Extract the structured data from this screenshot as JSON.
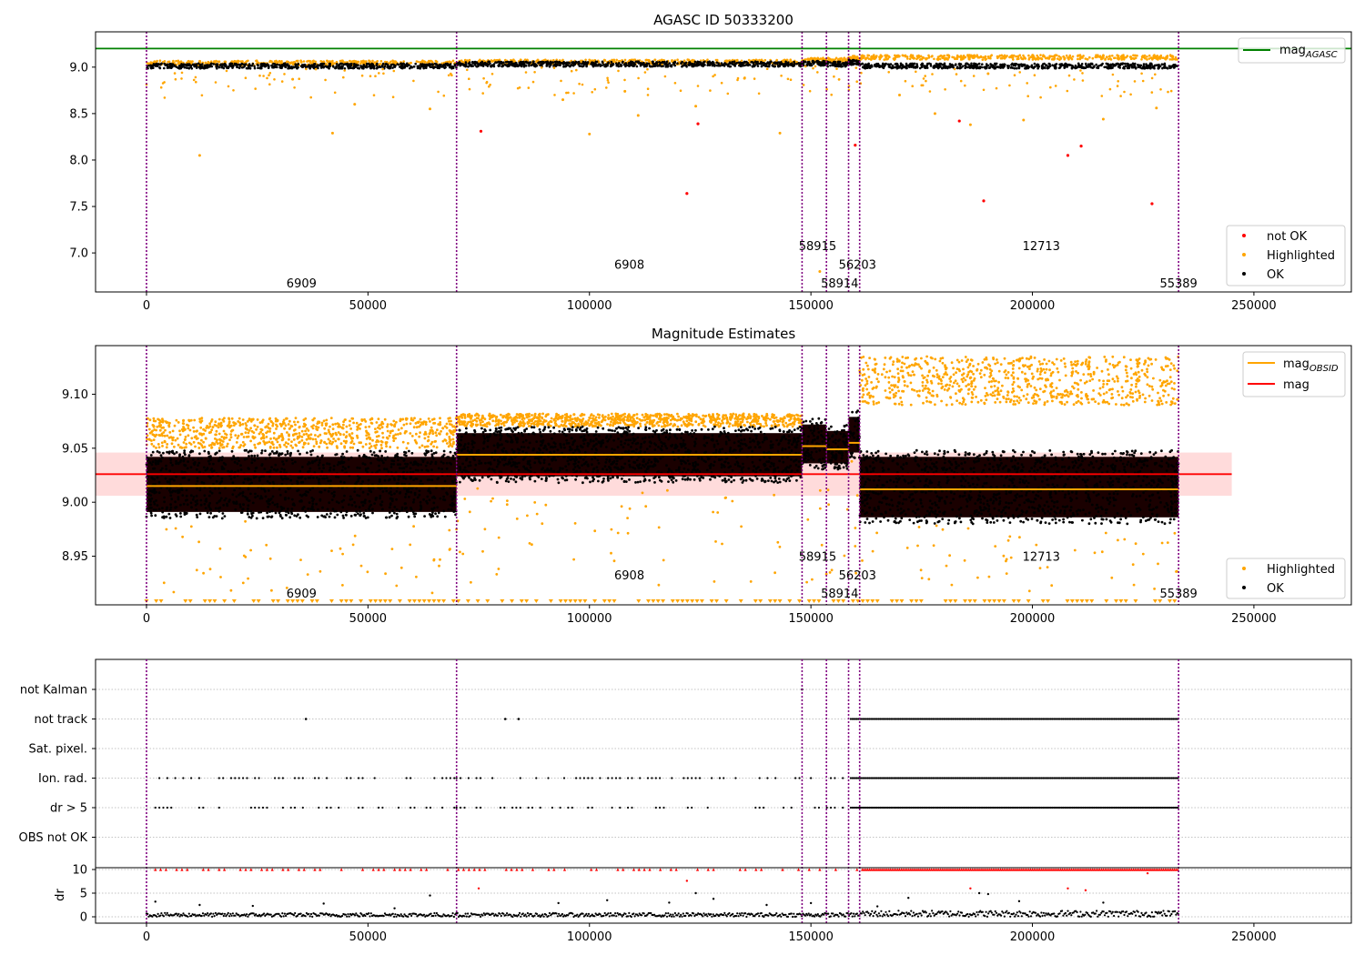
{
  "figure": {
    "colors": {
      "ok": "#000000",
      "highlighted": "#ffa500",
      "not_ok": "#ff0000",
      "agasc_line": "#008000",
      "mag_line": "#ff0000",
      "mag_band": "#ffcccc",
      "obsid_line": "#ffa500",
      "boundary": "#800080",
      "grid": "#b0b0b0"
    }
  },
  "chart_data": [
    {
      "type": "scatter",
      "title": "AGASC ID 50333200",
      "xlabel": "",
      "ylabel": "",
      "xlim": [
        -11500,
        272000
      ],
      "ylim": [
        6.58,
        9.38
      ],
      "x_ticks": [
        0,
        50000,
        100000,
        150000,
        200000,
        250000
      ],
      "x_tick_labels": [
        "0",
        "50000",
        "100000",
        "150000",
        "200000",
        "250000"
      ],
      "y_ticks": [
        7.0,
        7.5,
        8.0,
        8.5,
        9.0
      ],
      "y_tick_labels": [
        "7.0",
        "7.5",
        "8.0",
        "8.5",
        "9.0"
      ],
      "mag_agasc": 9.2,
      "obs_boundaries": [
        0,
        70000,
        148000,
        153500,
        158500,
        161000,
        233000
      ],
      "obs_labels": [
        {
          "text": "6909",
          "x": 35000,
          "y": 6.68
        },
        {
          "text": "6908",
          "x": 109000,
          "y": 6.88
        },
        {
          "text": "58915",
          "x": 151500,
          "y": 7.08
        },
        {
          "text": "58914",
          "x": 156500,
          "y": 6.68
        },
        {
          "text": "56203",
          "x": 160500,
          "y": 6.88
        },
        {
          "text": "12713",
          "x": 202000,
          "y": 7.08
        },
        {
          "text": "55389",
          "x": 233000,
          "y": 6.68
        }
      ],
      "bands": [
        {
          "x0": 0,
          "x1": 70000,
          "ok": 9.02,
          "hl": 9.05
        },
        {
          "x0": 70000,
          "x1": 148000,
          "ok": 9.04,
          "hl": 9.06
        },
        {
          "x0": 148000,
          "x1": 153500,
          "ok": 9.05,
          "hl": 9.08
        },
        {
          "x0": 153500,
          "x1": 158500,
          "ok": 9.04,
          "hl": 9.08
        },
        {
          "x0": 158500,
          "x1": 161000,
          "ok": 9.06,
          "hl": 9.1
        },
        {
          "x0": 161000,
          "x1": 233000,
          "ok": 9.02,
          "hl": 9.11
        }
      ],
      "highlighted_outliers": [
        [
          12000,
          8.05
        ],
        [
          42000,
          8.29
        ],
        [
          100000,
          8.28
        ],
        [
          143000,
          8.29
        ],
        [
          152000,
          6.8
        ],
        [
          178000,
          8.5
        ],
        [
          186000,
          8.38
        ],
        [
          198000,
          8.43
        ],
        [
          216000,
          8.44
        ],
        [
          228000,
          8.56
        ],
        [
          33000,
          8.87
        ],
        [
          47000,
          8.6
        ],
        [
          64000,
          8.55
        ],
        [
          94000,
          8.65
        ],
        [
          108000,
          8.74
        ],
        [
          111000,
          8.48
        ],
        [
          124000,
          8.58
        ],
        [
          135000,
          8.88
        ],
        [
          170000,
          8.7
        ],
        [
          190000,
          8.93
        ]
      ],
      "not_ok_points": [
        [
          75500,
          8.31
        ],
        [
          124500,
          8.39
        ],
        [
          122000,
          7.64
        ],
        [
          160000,
          8.16
        ],
        [
          183500,
          8.42
        ],
        [
          189000,
          7.56
        ],
        [
          208000,
          8.05
        ],
        [
          211000,
          8.15
        ],
        [
          227000,
          7.53
        ]
      ],
      "legend_line": [
        "mag_AGASC"
      ],
      "legend_points": [
        "not OK",
        "Highlighted",
        "OK"
      ]
    },
    {
      "type": "scatter",
      "title": "Magnitude Estimates",
      "xlabel": "",
      "ylabel": "",
      "xlim": [
        -11500,
        272000
      ],
      "ylim": [
        8.905,
        9.145
      ],
      "x_ticks": [
        0,
        50000,
        100000,
        150000,
        200000,
        250000
      ],
      "x_tick_labels": [
        "0",
        "50000",
        "100000",
        "150000",
        "200000",
        "250000"
      ],
      "y_ticks": [
        8.95,
        9.0,
        9.05,
        9.1
      ],
      "y_tick_labels": [
        "8.95",
        "9.00",
        "9.05",
        "9.10"
      ],
      "mag": 9.026,
      "mag_band": [
        9.006,
        9.046
      ],
      "mag_obsid": [
        {
          "x0": 0,
          "x1": 70000,
          "y": 9.015
        },
        {
          "x0": 70000,
          "x1": 148000,
          "y": 9.044
        },
        {
          "x0": 148000,
          "x1": 153500,
          "y": 9.052
        },
        {
          "x0": 153500,
          "x1": 158500,
          "y": 9.049
        },
        {
          "x0": 158500,
          "x1": 161000,
          "y": 9.055
        },
        {
          "x0": 161000,
          "x1": 233000,
          "y": 9.012
        }
      ],
      "ok_bands": [
        {
          "x0": 0,
          "x1": 70000,
          "lo": 8.985,
          "hi": 9.048
        },
        {
          "x0": 70000,
          "x1": 148000,
          "lo": 9.018,
          "hi": 9.07
        },
        {
          "x0": 148000,
          "x1": 153500,
          "lo": 9.03,
          "hi": 9.078
        },
        {
          "x0": 153500,
          "x1": 158500,
          "lo": 9.03,
          "hi": 9.072
        },
        {
          "x0": 158500,
          "x1": 161000,
          "lo": 9.04,
          "hi": 9.085
        },
        {
          "x0": 161000,
          "x1": 233000,
          "lo": 8.98,
          "hi": 9.048
        }
      ],
      "hl_bands": [
        {
          "x0": 0,
          "x1": 70000,
          "lo": 9.05,
          "hi": 9.078
        },
        {
          "x0": 70000,
          "x1": 148000,
          "lo": 9.07,
          "hi": 9.082
        },
        {
          "x0": 161000,
          "x1": 233000,
          "lo": 9.09,
          "hi": 9.135
        }
      ],
      "obs_boundaries": [
        0,
        70000,
        148000,
        153500,
        158500,
        161000,
        233000
      ],
      "obs_labels": [
        {
          "text": "6909",
          "x": 35000,
          "y": 8.916
        },
        {
          "text": "6908",
          "x": 109000,
          "y": 8.933
        },
        {
          "text": "58915",
          "x": 151500,
          "y": 8.95
        },
        {
          "text": "58914",
          "x": 156500,
          "y": 8.916
        },
        {
          "text": "56203",
          "x": 160500,
          "y": 8.933
        },
        {
          "text": "12713",
          "x": 202000,
          "y": 8.95
        },
        {
          "text": "55389",
          "x": 233000,
          "y": 8.916
        }
      ],
      "legend_line": [
        "mag_OBSID",
        "mag"
      ],
      "legend_points": [
        "Highlighted",
        "OK"
      ]
    },
    {
      "type": "scatter",
      "title": "",
      "xlabel": "",
      "ylabel": "",
      "xlim": [
        -11500,
        272000
      ],
      "x_ticks": [
        0,
        50000,
        100000,
        150000,
        200000,
        250000
      ],
      "x_tick_labels": [
        "0",
        "50000",
        "100000",
        "150000",
        "200000",
        "250000"
      ],
      "flag_rows": [
        "not Kalman",
        "not track",
        "Sat. pixel.",
        "Ion. rad.",
        "dr > 5",
        "OBS not OK"
      ],
      "flag_points": {
        "not Kalman": [
          [
            148000,
            148500
          ]
        ],
        "not track": [
          [
            36000,
            36500
          ],
          [
            81000,
            81500
          ],
          [
            84000,
            84500
          ],
          [
            159000,
            233000
          ]
        ],
        "Sat. pixel.": [],
        "Ion. rad.": [
          [
            2000,
            70000
          ],
          [
            70000,
            148000
          ],
          [
            150000,
            158000
          ],
          [
            159000,
            233000
          ]
        ],
        "dr > 5": [
          [
            2000,
            70000
          ],
          [
            70000,
            148000
          ],
          [
            150000,
            158000
          ],
          [
            159000,
            233000
          ]
        ],
        "OBS not OK": []
      },
      "grid": true
    },
    {
      "type": "scatter",
      "title": "",
      "xlabel": "",
      "ylabel": "dr",
      "xlim": [
        -11500,
        272000
      ],
      "ylim": [
        -0.5,
        10.5
      ],
      "x_ticks": [
        0,
        50000,
        100000,
        150000,
        200000,
        250000
      ],
      "x_tick_labels": [
        "0",
        "50000",
        "100000",
        "150000",
        "200000",
        "250000"
      ],
      "y_ticks": [
        0,
        5,
        10
      ],
      "y_tick_labels": [
        "0",
        "5",
        "10"
      ],
      "dr_high_value": 10,
      "dr_outliers": [
        [
          2000,
          3.2
        ],
        [
          12000,
          2.5
        ],
        [
          24000,
          2.3
        ],
        [
          40000,
          2.8
        ],
        [
          56000,
          1.8
        ],
        [
          64000,
          4.5
        ],
        [
          75000,
          6.0
        ],
        [
          93000,
          2.9
        ],
        [
          104000,
          3.5
        ],
        [
          118000,
          3.0
        ],
        [
          122000,
          7.6
        ],
        [
          124000,
          5.0
        ],
        [
          128000,
          3.8
        ],
        [
          140000,
          2.5
        ],
        [
          150000,
          2.9
        ],
        [
          165000,
          2.2
        ],
        [
          172000,
          4.0
        ],
        [
          186000,
          6.0
        ],
        [
          188000,
          5.0
        ],
        [
          190000,
          4.8
        ],
        [
          197000,
          3.3
        ],
        [
          208000,
          6.0
        ],
        [
          212000,
          5.6
        ],
        [
          216000,
          3.0
        ],
        [
          226000,
          9.2
        ]
      ],
      "grid": true
    }
  ]
}
